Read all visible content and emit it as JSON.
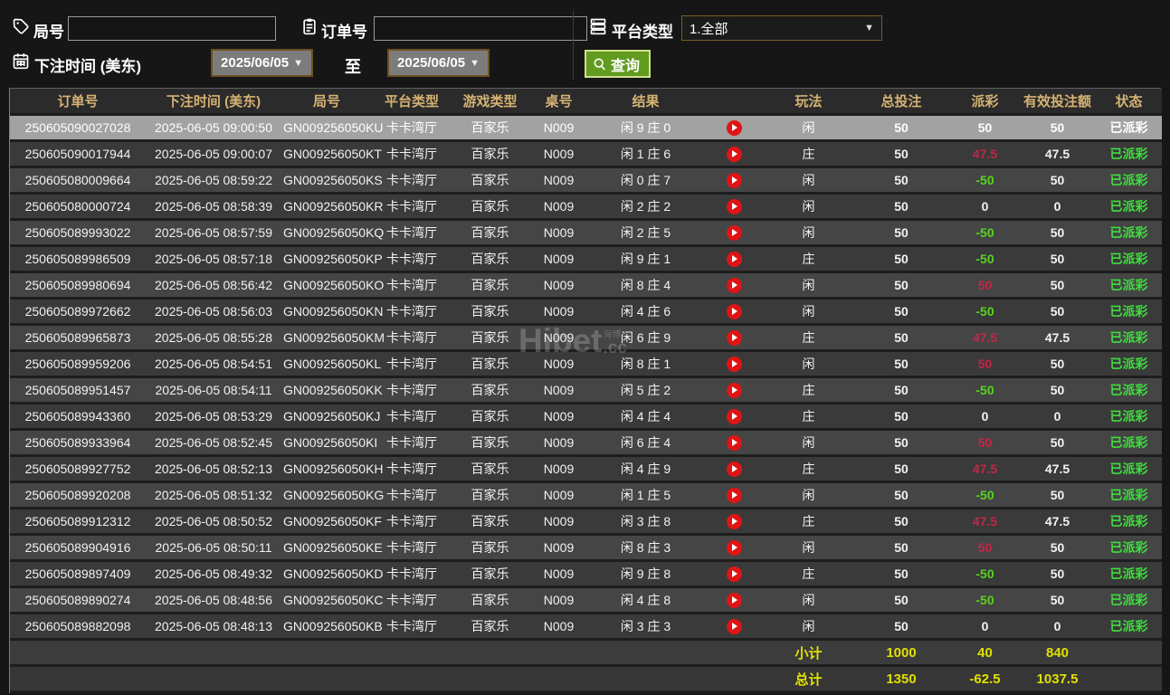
{
  "filters": {
    "game_no_label": "局号",
    "order_no_label": "订单号",
    "platform_label": "平台类型",
    "platform_value": "1.全部",
    "bet_time_label": "下注时间 (美东)",
    "date_from": "2025/06/05",
    "date_to": "2025/06/05",
    "to_label": "至",
    "search_label": "查询",
    "game_no_value": "",
    "order_no_value": ""
  },
  "watermark": {
    "brand": "Hibet",
    "small": "海博",
    "suffix": ".cc"
  },
  "colors": {
    "accent_green": "#619b1f",
    "header_text": "#d6b273",
    "payout_win": "#c22747",
    "payout_loss": "#55d41f",
    "status_paid": "#3fdd3f",
    "summary_yellow": "#e0e000",
    "selected_row": "#a2a2a2"
  },
  "table": {
    "columns": {
      "order": "订单号",
      "time": "下注时间 (美东)",
      "game_no": "局号",
      "platform": "平台类型",
      "game_type": "游戏类型",
      "table_no": "桌号",
      "result": "结果",
      "replay": "",
      "play": "玩法",
      "bet": "总投注",
      "payout": "派彩",
      "valid": "有效投注额",
      "status": "状态"
    },
    "rows": [
      {
        "selected": true,
        "order": "250605090027028",
        "time": "2025-06-05 09:00:50",
        "game_no": "GN009256050KU",
        "platform": "卡卡湾厅",
        "game_type": "百家乐",
        "table_no": "N009",
        "result": "闲 9 庄 0",
        "play": "闲",
        "bet": "50",
        "payout": "50",
        "payout_color": "win",
        "valid": "50",
        "status": "已派彩"
      },
      {
        "selected": false,
        "order": "250605090017944",
        "time": "2025-06-05 09:00:07",
        "game_no": "GN009256050KT",
        "platform": "卡卡湾厅",
        "game_type": "百家乐",
        "table_no": "N009",
        "result": "闲 1 庄 6",
        "play": "庄",
        "bet": "50",
        "payout": "47.5",
        "payout_color": "win",
        "valid": "47.5",
        "status": "已派彩"
      },
      {
        "selected": false,
        "order": "250605080009664",
        "time": "2025-06-05 08:59:22",
        "game_no": "GN009256050KS",
        "platform": "卡卡湾厅",
        "game_type": "百家乐",
        "table_no": "N009",
        "result": "闲 0 庄 7",
        "play": "闲",
        "bet": "50",
        "payout": "-50",
        "payout_color": "loss",
        "valid": "50",
        "status": "已派彩"
      },
      {
        "selected": false,
        "order": "250605080000724",
        "time": "2025-06-05 08:58:39",
        "game_no": "GN009256050KR",
        "platform": "卡卡湾厅",
        "game_type": "百家乐",
        "table_no": "N009",
        "result": "闲 2 庄 2",
        "play": "闲",
        "bet": "50",
        "payout": "0",
        "payout_color": "even",
        "valid": "0",
        "status": "已派彩"
      },
      {
        "selected": false,
        "order": "250605089993022",
        "time": "2025-06-05 08:57:59",
        "game_no": "GN009256050KQ",
        "platform": "卡卡湾厅",
        "game_type": "百家乐",
        "table_no": "N009",
        "result": "闲 2 庄 5",
        "play": "闲",
        "bet": "50",
        "payout": "-50",
        "payout_color": "loss",
        "valid": "50",
        "status": "已派彩"
      },
      {
        "selected": false,
        "order": "250605089986509",
        "time": "2025-06-05 08:57:18",
        "game_no": "GN009256050KP",
        "platform": "卡卡湾厅",
        "game_type": "百家乐",
        "table_no": "N009",
        "result": "闲 9 庄 1",
        "play": "庄",
        "bet": "50",
        "payout": "-50",
        "payout_color": "loss",
        "valid": "50",
        "status": "已派彩"
      },
      {
        "selected": false,
        "order": "250605089980694",
        "time": "2025-06-05 08:56:42",
        "game_no": "GN009256050KO",
        "platform": "卡卡湾厅",
        "game_type": "百家乐",
        "table_no": "N009",
        "result": "闲 8 庄 4",
        "play": "闲",
        "bet": "50",
        "payout": "50",
        "payout_color": "win",
        "valid": "50",
        "status": "已派彩"
      },
      {
        "selected": false,
        "order": "250605089972662",
        "time": "2025-06-05 08:56:03",
        "game_no": "GN009256050KN",
        "platform": "卡卡湾厅",
        "game_type": "百家乐",
        "table_no": "N009",
        "result": "闲 4 庄 6",
        "play": "闲",
        "bet": "50",
        "payout": "-50",
        "payout_color": "loss",
        "valid": "50",
        "status": "已派彩"
      },
      {
        "selected": false,
        "order": "250605089965873",
        "time": "2025-06-05 08:55:28",
        "game_no": "GN009256050KM",
        "platform": "卡卡湾厅",
        "game_type": "百家乐",
        "table_no": "N009",
        "result": "闲 6 庄 9",
        "play": "庄",
        "bet": "50",
        "payout": "47.5",
        "payout_color": "win",
        "valid": "47.5",
        "status": "已派彩"
      },
      {
        "selected": false,
        "order": "250605089959206",
        "time": "2025-06-05 08:54:51",
        "game_no": "GN009256050KL",
        "platform": "卡卡湾厅",
        "game_type": "百家乐",
        "table_no": "N009",
        "result": "闲 8 庄 1",
        "play": "闲",
        "bet": "50",
        "payout": "50",
        "payout_color": "win",
        "valid": "50",
        "status": "已派彩"
      },
      {
        "selected": false,
        "order": "250605089951457",
        "time": "2025-06-05 08:54:11",
        "game_no": "GN009256050KK",
        "platform": "卡卡湾厅",
        "game_type": "百家乐",
        "table_no": "N009",
        "result": "闲 5 庄 2",
        "play": "庄",
        "bet": "50",
        "payout": "-50",
        "payout_color": "loss",
        "valid": "50",
        "status": "已派彩"
      },
      {
        "selected": false,
        "order": "250605089943360",
        "time": "2025-06-05 08:53:29",
        "game_no": "GN009256050KJ",
        "platform": "卡卡湾厅",
        "game_type": "百家乐",
        "table_no": "N009",
        "result": "闲 4 庄 4",
        "play": "庄",
        "bet": "50",
        "payout": "0",
        "payout_color": "even",
        "valid": "0",
        "status": "已派彩"
      },
      {
        "selected": false,
        "order": "250605089933964",
        "time": "2025-06-05 08:52:45",
        "game_no": "GN009256050KI",
        "platform": "卡卡湾厅",
        "game_type": "百家乐",
        "table_no": "N009",
        "result": "闲 6 庄 4",
        "play": "闲",
        "bet": "50",
        "payout": "50",
        "payout_color": "win",
        "valid": "50",
        "status": "已派彩"
      },
      {
        "selected": false,
        "order": "250605089927752",
        "time": "2025-06-05 08:52:13",
        "game_no": "GN009256050KH",
        "platform": "卡卡湾厅",
        "game_type": "百家乐",
        "table_no": "N009",
        "result": "闲 4 庄 9",
        "play": "庄",
        "bet": "50",
        "payout": "47.5",
        "payout_color": "win",
        "valid": "47.5",
        "status": "已派彩"
      },
      {
        "selected": false,
        "order": "250605089920208",
        "time": "2025-06-05 08:51:32",
        "game_no": "GN009256050KG",
        "platform": "卡卡湾厅",
        "game_type": "百家乐",
        "table_no": "N009",
        "result": "闲 1 庄 5",
        "play": "闲",
        "bet": "50",
        "payout": "-50",
        "payout_color": "loss",
        "valid": "50",
        "status": "已派彩"
      },
      {
        "selected": false,
        "order": "250605089912312",
        "time": "2025-06-05 08:50:52",
        "game_no": "GN009256050KF",
        "platform": "卡卡湾厅",
        "game_type": "百家乐",
        "table_no": "N009",
        "result": "闲 3 庄 8",
        "play": "庄",
        "bet": "50",
        "payout": "47.5",
        "payout_color": "win",
        "valid": "47.5",
        "status": "已派彩"
      },
      {
        "selected": false,
        "order": "250605089904916",
        "time": "2025-06-05 08:50:11",
        "game_no": "GN009256050KE",
        "platform": "卡卡湾厅",
        "game_type": "百家乐",
        "table_no": "N009",
        "result": "闲 8 庄 3",
        "play": "闲",
        "bet": "50",
        "payout": "50",
        "payout_color": "win",
        "valid": "50",
        "status": "已派彩"
      },
      {
        "selected": false,
        "order": "250605089897409",
        "time": "2025-06-05 08:49:32",
        "game_no": "GN009256050KD",
        "platform": "卡卡湾厅",
        "game_type": "百家乐",
        "table_no": "N009",
        "result": "闲 9 庄 8",
        "play": "庄",
        "bet": "50",
        "payout": "-50",
        "payout_color": "loss",
        "valid": "50",
        "status": "已派彩"
      },
      {
        "selected": false,
        "order": "250605089890274",
        "time": "2025-06-05 08:48:56",
        "game_no": "GN009256050KC",
        "platform": "卡卡湾厅",
        "game_type": "百家乐",
        "table_no": "N009",
        "result": "闲 4 庄 8",
        "play": "闲",
        "bet": "50",
        "payout": "-50",
        "payout_color": "loss",
        "valid": "50",
        "status": "已派彩"
      },
      {
        "selected": false,
        "order": "250605089882098",
        "time": "2025-06-05 08:48:13",
        "game_no": "GN009256050KB",
        "platform": "卡卡湾厅",
        "game_type": "百家乐",
        "table_no": "N009",
        "result": "闲 3 庄 3",
        "play": "闲",
        "bet": "50",
        "payout": "0",
        "payout_color": "even",
        "valid": "0",
        "status": "已派彩"
      }
    ],
    "subtotal": {
      "label": "小计",
      "bet": "1000",
      "payout": "40",
      "valid": "840"
    },
    "total": {
      "label": "总计",
      "bet": "1350",
      "payout": "-62.5",
      "valid": "1037.5"
    }
  }
}
